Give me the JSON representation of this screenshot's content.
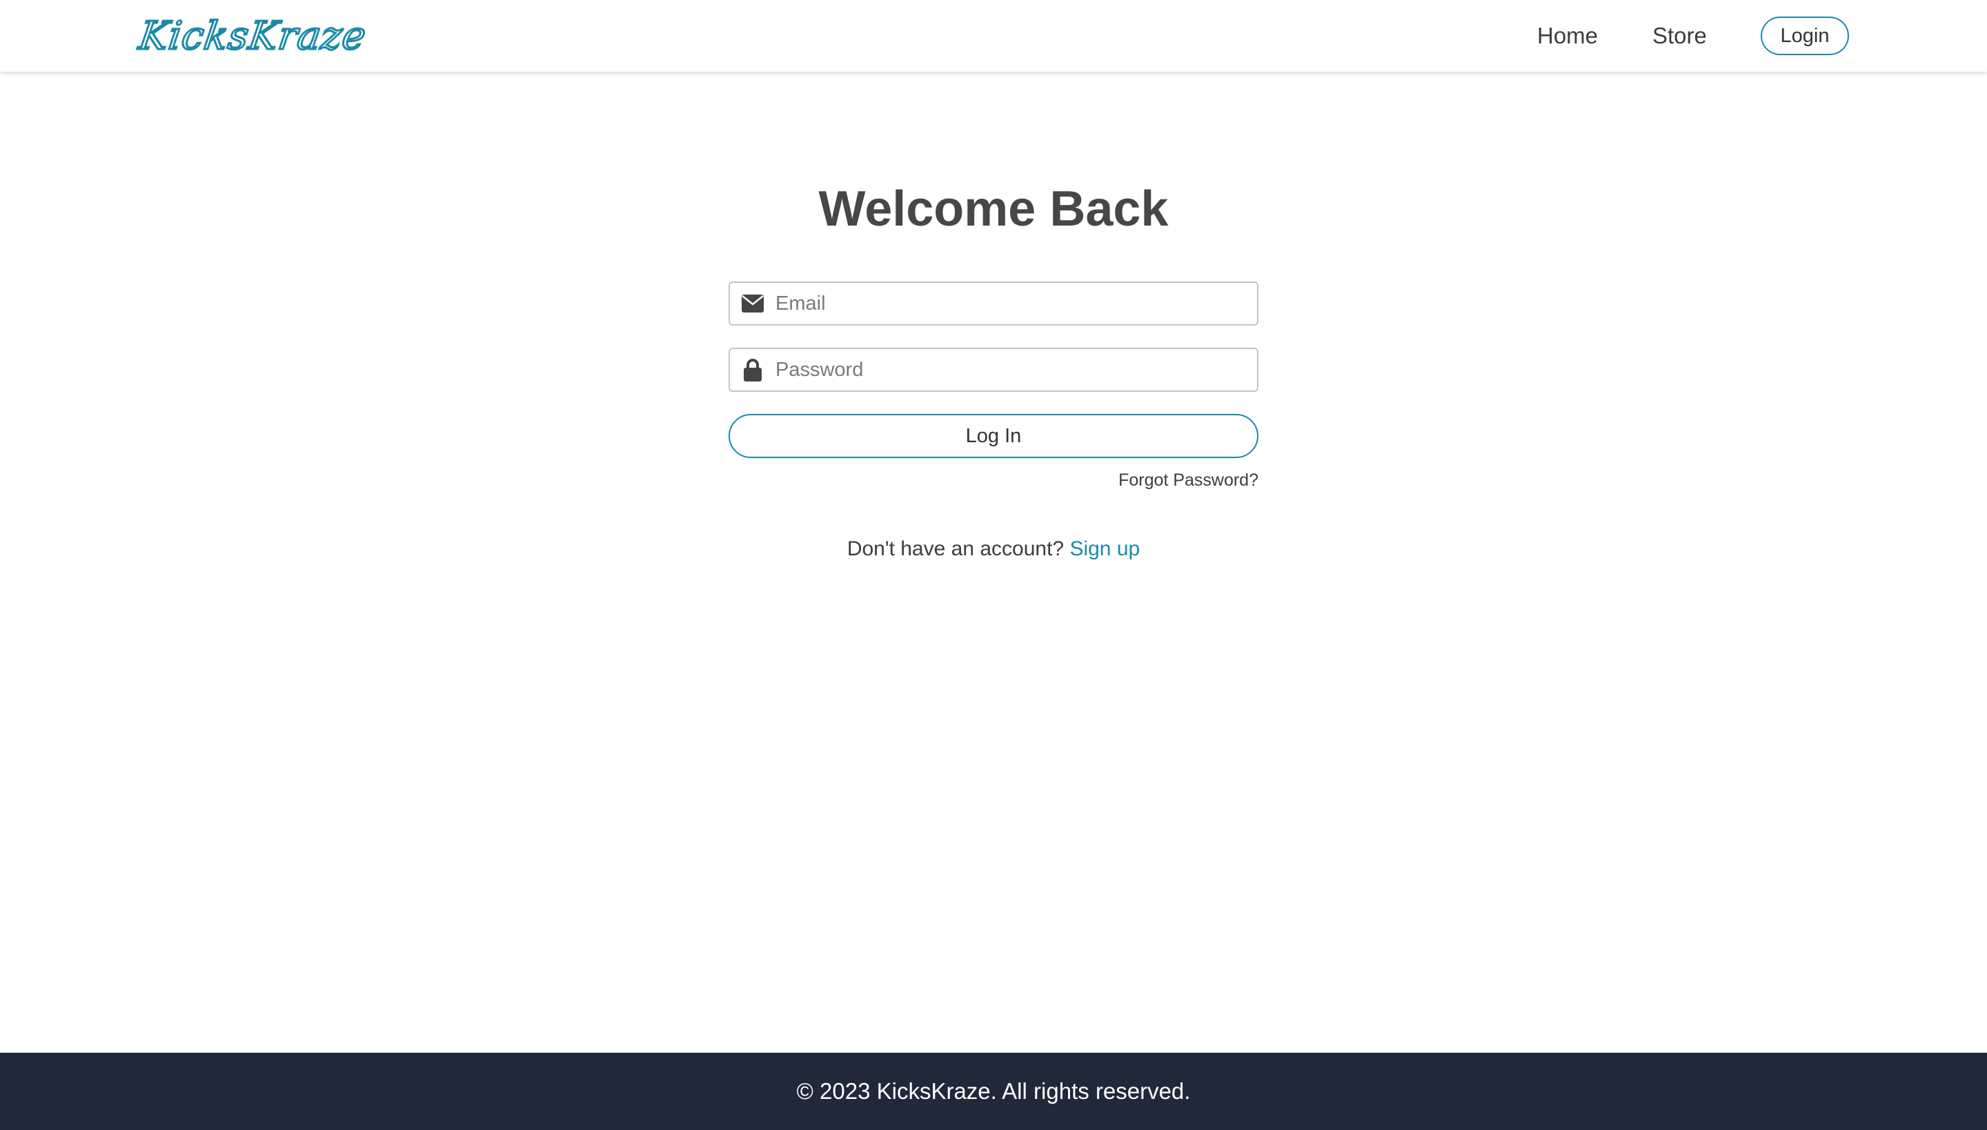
{
  "header": {
    "logo": "KicksKraze",
    "nav": [
      {
        "label": "Home"
      },
      {
        "label": "Store"
      }
    ],
    "login_button": "Login"
  },
  "login_form": {
    "title": "Welcome Back",
    "email": {
      "placeholder": "Email",
      "value": "",
      "icon": "envelope-icon"
    },
    "password": {
      "placeholder": "Password",
      "value": "",
      "icon": "lock-icon"
    },
    "submit_label": "Log In",
    "forgot_password": "Forgot Password?",
    "signup_prompt": "Don't have an account?",
    "signup_link": "Sign up"
  },
  "footer": {
    "copyright": "© 2023 KicksKraze. All rights reserved."
  },
  "colors": {
    "accent": "#1a8aa8",
    "footer_bg": "#20293a",
    "heading": "#474747"
  }
}
